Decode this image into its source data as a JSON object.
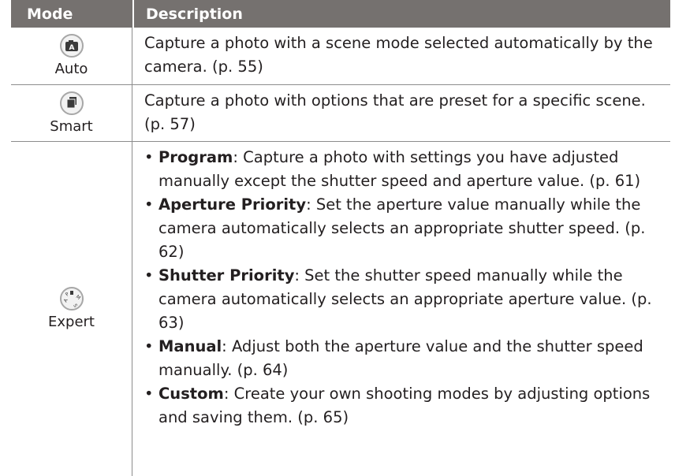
{
  "table": {
    "header": {
      "mode": "Mode",
      "description": "Description"
    },
    "rows": [
      {
        "mode": "Auto",
        "icon": "auto-mode-icon",
        "description": "Capture a photo with a scene mode selected automatically by the camera. (p. 55)"
      },
      {
        "mode": "Smart",
        "icon": "smart-mode-icon",
        "description": "Capture a photo with options that are preset for a specific scene. (p. 57)"
      },
      {
        "mode": "Expert",
        "icon": "expert-mode-dial-icon",
        "items": [
          {
            "term": "Program",
            "text": ": Capture a photo with settings you have adjusted manually except the shutter speed and aperture value. (p. 61)"
          },
          {
            "term": "Aperture Priority",
            "text": ": Set the aperture value manually while the camera automatically selects an appropriate shutter speed. (p. 62)"
          },
          {
            "term": "Shutter Priority",
            "text": ": Set the shutter speed manually while the camera automatically selects an appropriate aperture value. (p. 63)"
          },
          {
            "term": "Manual",
            "text": ": Adjust both the aperture value and the shutter speed manually. (p. 64)"
          },
          {
            "term": "Custom",
            "text": ": Create your own shooting modes by adjusting options and saving them. (p. 65)"
          }
        ]
      }
    ]
  },
  "colors": {
    "header_bg": "#75716f",
    "rule": "#8c8c8c",
    "text": "#231f20"
  }
}
